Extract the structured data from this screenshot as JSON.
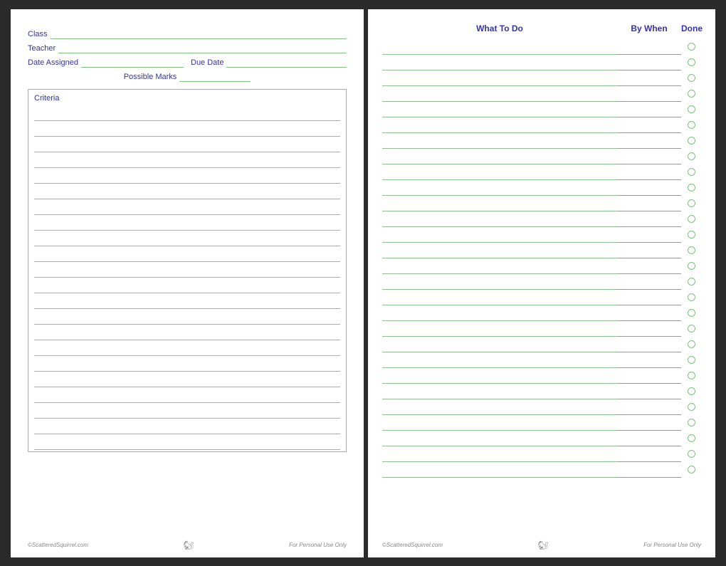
{
  "left": {
    "fields": {
      "class_label": "Class",
      "teacher_label": "Teacher",
      "date_assigned_label": "Date Assigned",
      "due_date_label": "Due Date",
      "possible_marks_label": "Possible Marks",
      "criteria_label": "Criteria"
    },
    "footer": {
      "copyright": "©ScatteredSquirrel.com",
      "personal": "For Personal Use Only"
    },
    "criteria_line_count": 22
  },
  "right": {
    "header": {
      "what_to_do": "What To Do",
      "by_when": "By When",
      "done": "Done"
    },
    "row_count": 28,
    "footer": {
      "copyright": "©ScatteredSquirrel.com",
      "personal": "For Personal Use Only"
    }
  }
}
